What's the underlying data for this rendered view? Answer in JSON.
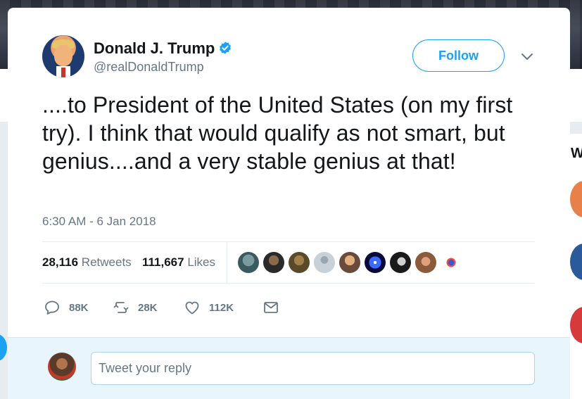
{
  "tweet": {
    "author_name": "Donald J. Trump",
    "author_handle": "@realDonaldTrump",
    "verified": true,
    "follow_label": "Follow",
    "text": "....to President of the United States (on my first try). I think that would qualify as not smart, but genius....and a very stable genius at that!",
    "timestamp": "6:30 AM - 6 Jan 2018",
    "retweets_count": "28,116",
    "retweets_label": "Retweets",
    "likes_count": "111,667",
    "likes_label": "Likes",
    "liker_avatars": [
      "liker-avatar-1",
      "liker-avatar-2",
      "liker-avatar-3",
      "liker-avatar-4",
      "liker-avatar-5",
      "liker-avatar-6",
      "liker-avatar-7",
      "liker-avatar-8",
      "liker-avatar-9"
    ]
  },
  "actions": {
    "reply": {
      "icon": "reply-icon",
      "count": "88K"
    },
    "retweet": {
      "icon": "retweet-icon",
      "count": "28K"
    },
    "like": {
      "icon": "heart-icon",
      "count": "112K"
    },
    "message": {
      "icon": "envelope-icon"
    }
  },
  "reply": {
    "placeholder": "Tweet your reply"
  },
  "colors": {
    "accent": "#1da1f2",
    "secondary_text": "#657786",
    "reply_bar_bg": "#e8f5fd"
  }
}
